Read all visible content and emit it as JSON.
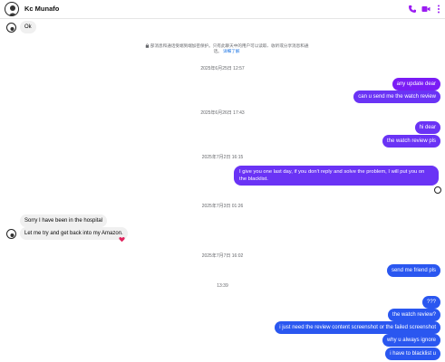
{
  "header": {
    "contact_name": "Kc Munafo",
    "icons": [
      "phone-icon",
      "video-icon",
      "more-icon"
    ],
    "accent_color": "#9b1cf2"
  },
  "notice": {
    "text": "部消息和通话受端到端加密保护。只有此聊天中的用户可以读取、收听或分享消息和通话。",
    "link": "详细了解"
  },
  "messages": {
    "m1": "Ok",
    "m2": "any update dear",
    "m3": "can u send me the watch review",
    "m4": "hi dear",
    "m5": "the watch review pls",
    "m6_line1": "I give you one last day, if you don't reply and solve the problem, I will put you on",
    "m6_line2": "the blacklist.",
    "m7": "Sorry I have been in the hospital",
    "m8": "Let me try and get back into my Amazon.",
    "m9": "send me friend pls",
    "m10": "???",
    "m11": "the watch review?",
    "m12": "i just need the review content screenshot or the failed screenshot",
    "m13": "why u always ignore",
    "m14": "i have to blacklist u"
  },
  "timestamps": {
    "t1": "2025年6月25日 12:57",
    "t2": "2025年6月26日 17:43",
    "t3": "2025年7月2日 16:15",
    "t4": "2025年7月3日 01:26",
    "t5": "2025年7月7日 16:02",
    "t6": "13:39"
  },
  "colors": {
    "bubble_purple": "#7a1cf5",
    "bubble_violet": "#6a33f5",
    "bubble_blue": "#2a57f0",
    "bubble_incoming": "#f0f0f0"
  }
}
